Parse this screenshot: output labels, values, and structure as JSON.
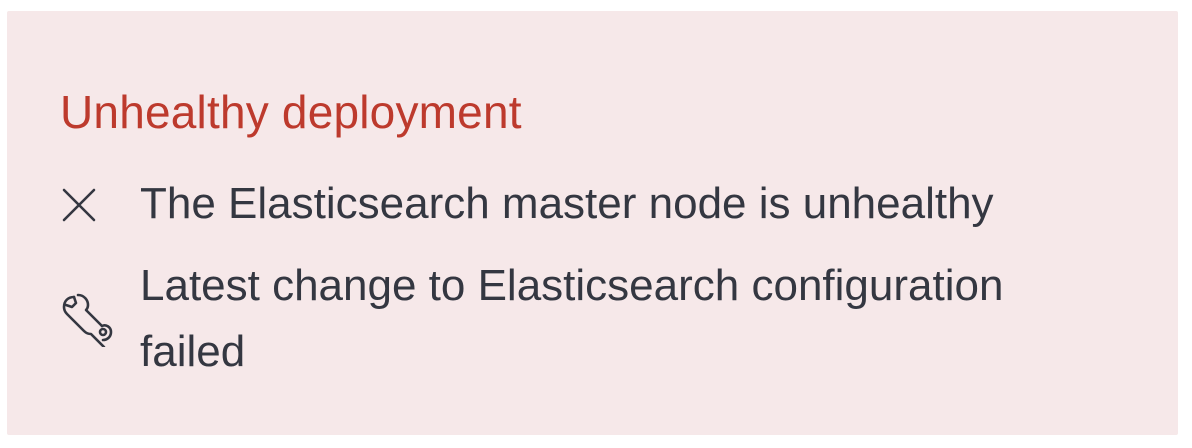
{
  "colors": {
    "callout_background": "#f6e8e9",
    "title": "#bd3a2d",
    "text": "#343741",
    "icon": "#343741"
  },
  "callout": {
    "title": "Unhealthy deployment",
    "items": [
      {
        "icon": "cross-icon",
        "text": "The Elasticsearch master node is unhealthy"
      },
      {
        "icon": "wrench-icon",
        "text": "Latest change to Elasticsearch configuration failed"
      }
    ]
  }
}
